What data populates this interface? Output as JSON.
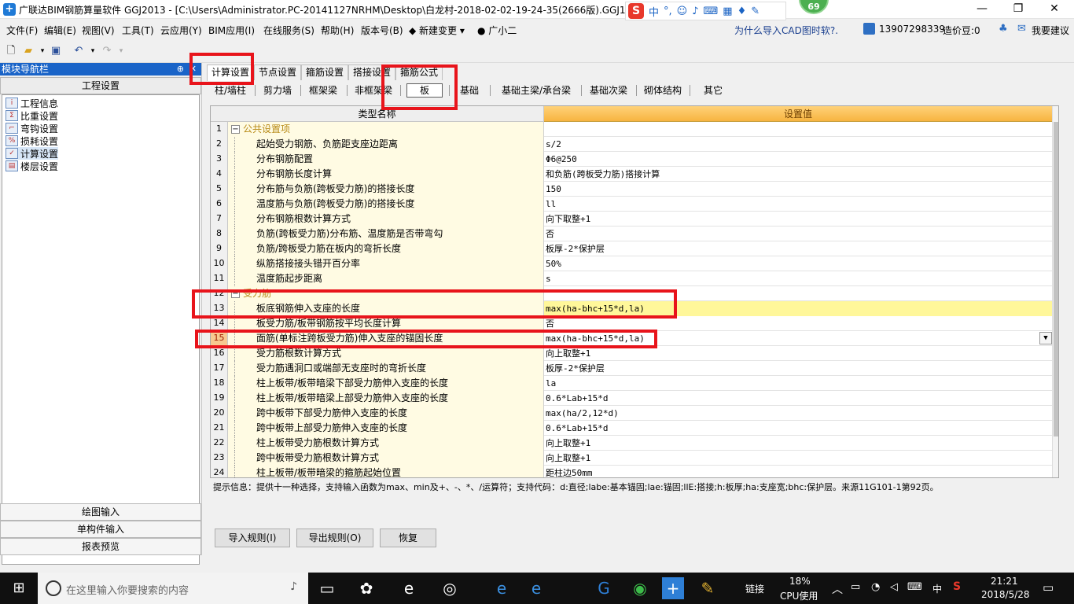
{
  "window": {
    "title": "广联达BIM钢筋算量软件 GGJ2013 - [C:\\Users\\Administrator.PC-20141127NRHM\\Desktop\\白龙村-2018-02-02-19-24-35(2666版).GGJ12]",
    "badge": "69",
    "ime_label": "中"
  },
  "menu": {
    "items": [
      "文件(F)",
      "编辑(E)",
      "视图(V)",
      "工具(T)",
      "云应用(Y)",
      "BIM应用(I)",
      "在线服务(S)",
      "帮助(H)",
      "版本号(B)",
      "新建变更",
      "广小二"
    ],
    "cad_link": "为什么导入CAD图时软?.",
    "phone": "13907298339",
    "coins": "造价豆:0",
    "suggest": "我要建议"
  },
  "nav": {
    "header": "模块导航栏",
    "section": "工程设置",
    "items": [
      "工程信息",
      "比重设置",
      "弯钩设置",
      "损耗设置",
      "计算设置",
      "楼层设置"
    ],
    "bottom": [
      "绘图输入",
      "单构件输入",
      "报表预览"
    ]
  },
  "tabs": [
    "计算设置",
    "节点设置",
    "箍筋设置",
    "搭接设置",
    "箍筋公式"
  ],
  "subtabs": [
    "柱/墙柱",
    "剪力墙",
    "框架梁",
    "非框架梁",
    "板",
    "基础",
    "基础主梁/承台梁",
    "基础次梁",
    "砌体结构",
    "其它"
  ],
  "grid": {
    "col_name": "类型名称",
    "col_value": "设置值",
    "rows": [
      {
        "n": "1",
        "name": "公共设置项",
        "value": ""
      },
      {
        "n": "2",
        "name": "起始受力钢筋、负筋距支座边距离",
        "value": "s/2"
      },
      {
        "n": "3",
        "name": "分布钢筋配置",
        "value": "Φ6@250"
      },
      {
        "n": "4",
        "name": "分布钢筋长度计算",
        "value": "和负筋(跨板受力筋)搭接计算"
      },
      {
        "n": "5",
        "name": "分布筋与负筋(跨板受力筋)的搭接长度",
        "value": "150"
      },
      {
        "n": "6",
        "name": "温度筋与负筋(跨板受力筋)的搭接长度",
        "value": "ll"
      },
      {
        "n": "7",
        "name": "分布钢筋根数计算方式",
        "value": "向下取整+1"
      },
      {
        "n": "8",
        "name": "负筋(跨板受力筋)分布筋、温度筋是否带弯勾",
        "value": "否"
      },
      {
        "n": "9",
        "name": "负筋/跨板受力筋在板内的弯折长度",
        "value": "板厚-2*保护层"
      },
      {
        "n": "10",
        "name": "纵筋搭接接头错开百分率",
        "value": "50%"
      },
      {
        "n": "11",
        "name": "温度筋起步距离",
        "value": "s"
      },
      {
        "n": "12",
        "name": "受力筋",
        "value": ""
      },
      {
        "n": "13",
        "name": "板底钢筋伸入支座的长度",
        "value": "max(ha-bhc+15*d,la)"
      },
      {
        "n": "14",
        "name": "板受力筋/板带钢筋按平均长度计算",
        "value": "否"
      },
      {
        "n": "15",
        "name": "面筋(单标注跨板受力筋)伸入支座的锚固长度",
        "value": "max(ha-bhc+15*d,la)"
      },
      {
        "n": "16",
        "name": "受力筋根数计算方式",
        "value": "向上取整+1"
      },
      {
        "n": "17",
        "name": "受力筋遇洞口或端部无支座时的弯折长度",
        "value": "板厚-2*保护层"
      },
      {
        "n": "18",
        "name": "柱上板带/板带暗梁下部受力筋伸入支座的长度",
        "value": "la"
      },
      {
        "n": "19",
        "name": "柱上板带/板带暗梁上部受力筋伸入支座的长度",
        "value": "0.6*Lab+15*d"
      },
      {
        "n": "20",
        "name": "跨中板带下部受力筋伸入支座的长度",
        "value": "max(ha/2,12*d)"
      },
      {
        "n": "21",
        "name": "跨中板带上部受力筋伸入支座的长度",
        "value": "0.6*Lab+15*d"
      },
      {
        "n": "22",
        "name": "柱上板带受力筋根数计算方式",
        "value": "向上取整+1"
      },
      {
        "n": "23",
        "name": "跨中板带受力筋根数计算方式",
        "value": "向上取整+1"
      },
      {
        "n": "24",
        "name": "柱上板带/板带暗梁的箍筋起始位置",
        "value": "距柱边50mm"
      }
    ]
  },
  "hint": "提示信息：提供十一种选择，支持输入函数为max、min及+、-、*、/运算符；支持代码：d:直径;labe:基本锚固;lae:锚固;llE:搭接;h:板厚;ha:支座宽;bhc:保护层。来源11G101-1第92页。",
  "buttons": [
    "导入规则(I)",
    "导出规则(O)",
    "恢复"
  ],
  "taskbar": {
    "search_placeholder": "在这里输入你要搜索的内容",
    "links": "链接",
    "cpu_pct": "18%",
    "cpu_label": "CPU使用",
    "ime": "中",
    "time": "21:21",
    "date": "2018/5/28"
  }
}
